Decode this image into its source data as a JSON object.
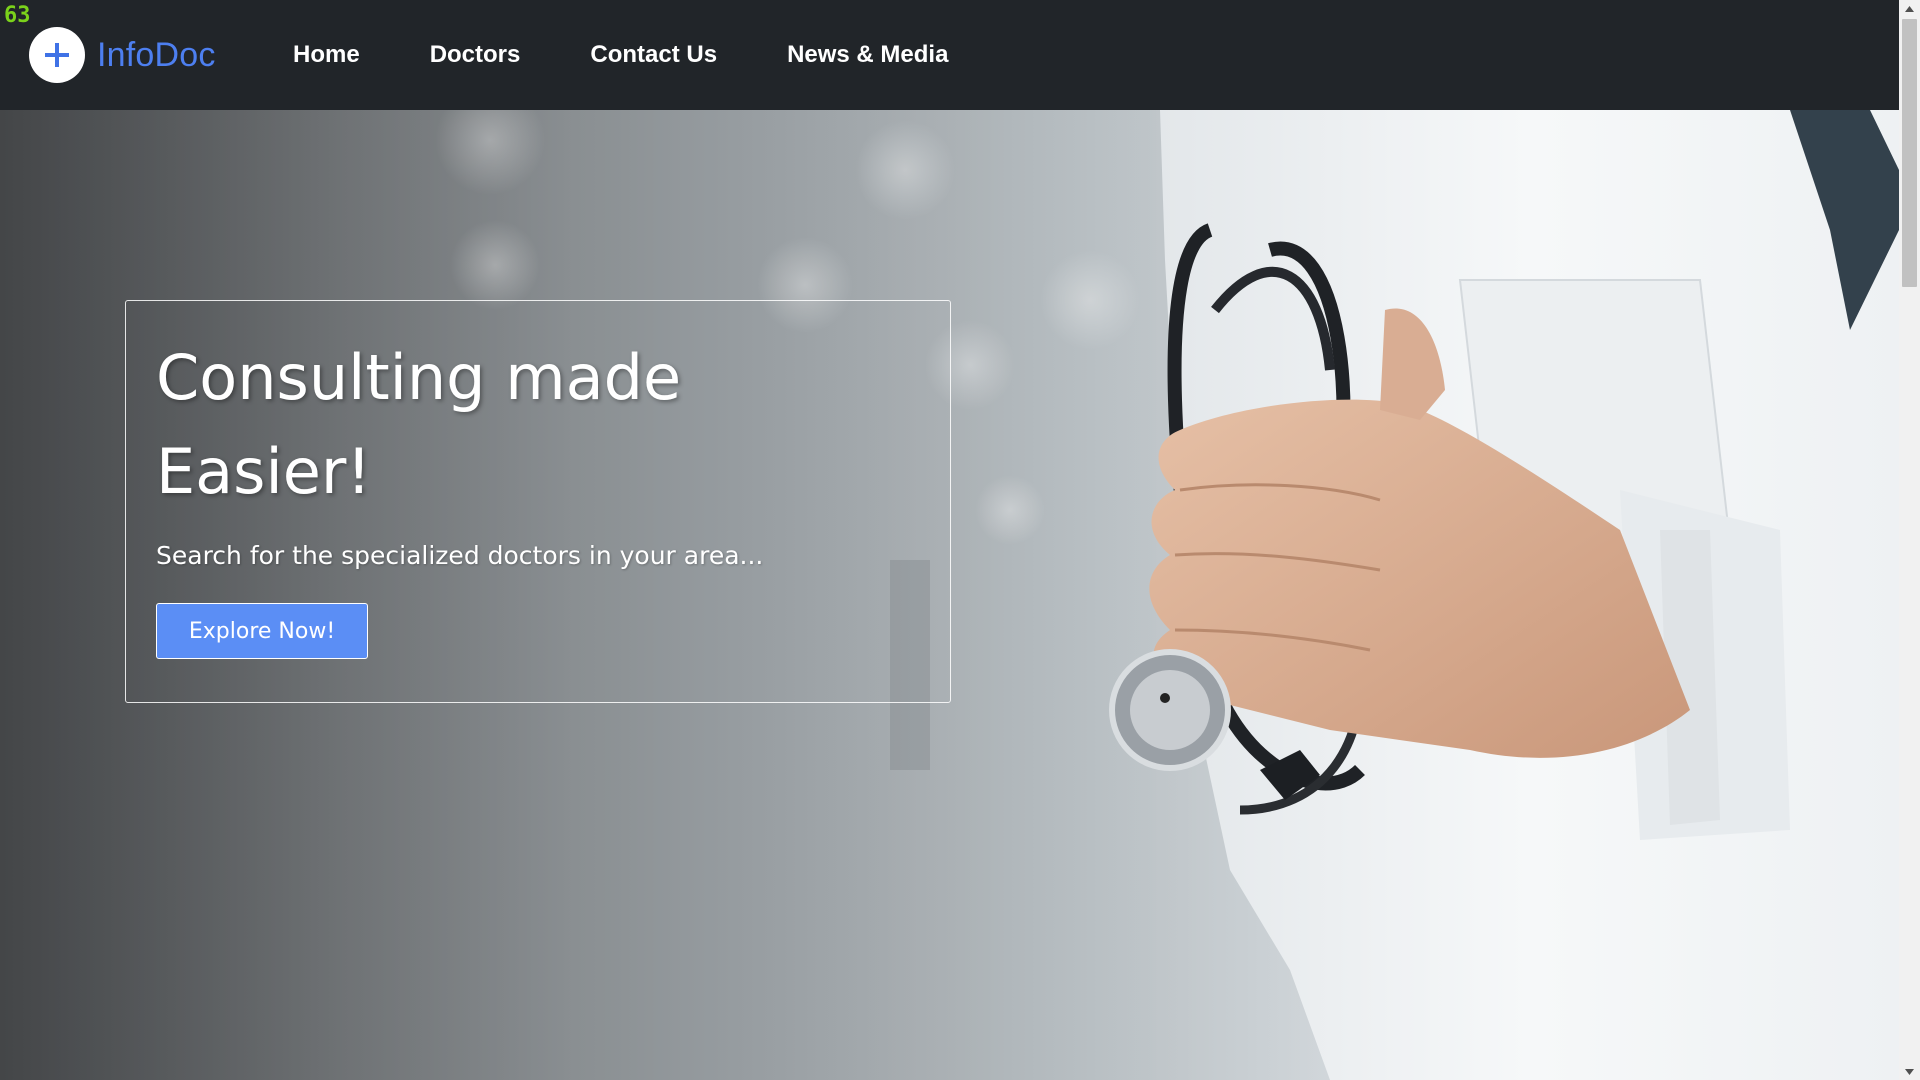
{
  "overlay": {
    "fps_counter": "63"
  },
  "navbar": {
    "brand": {
      "name": "InfoDoc",
      "logo_icon": "plus-icon"
    },
    "links": [
      {
        "label": "Home"
      },
      {
        "label": "Doctors"
      },
      {
        "label": "Contact Us"
      },
      {
        "label": "News & Media"
      }
    ]
  },
  "hero": {
    "title_line_1": "Consulting made",
    "title_line_2": "Easier!",
    "subtitle": "Search for the specialized doctors in your area...",
    "button_label": "Explore Now!",
    "background_image": "doctor-with-stethoscope-photo"
  },
  "colors": {
    "navbar_background": "#212529",
    "brand_accent": "#4d7ff0",
    "button_background": "#5b8ef5",
    "fps_counter": "#7bd21b"
  }
}
